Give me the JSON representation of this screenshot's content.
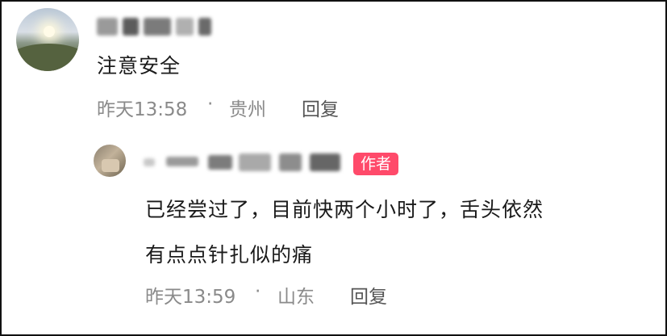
{
  "comment": {
    "text": "注意安全",
    "time": "昨天13:58",
    "separator": "·",
    "location": "贵州",
    "reply_label": "回复"
  },
  "reply": {
    "badge": "作者",
    "text_line1": "已经尝过了，目前快两个小时了，舌头依然",
    "text_line2": "有点点针扎似的痛",
    "time": "昨天13:59",
    "separator": "·",
    "location": "山东",
    "reply_label": "回复"
  },
  "colors": {
    "badge_bg": "#ff4a6a",
    "meta_gray": "#8a8a8a"
  }
}
